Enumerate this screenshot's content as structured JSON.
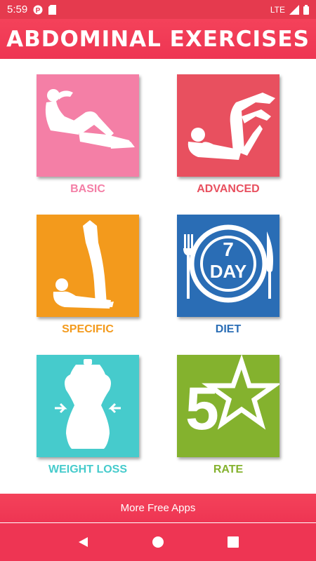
{
  "status_bar": {
    "time": "5:59",
    "network": "LTE"
  },
  "header": {
    "title": "ABDOMINAL EXERCISES"
  },
  "tiles": [
    {
      "label": "BASIC",
      "color": "#f47fa6",
      "label_color": "#f47fa6",
      "icon": "crunch-figure-icon"
    },
    {
      "label": "ADVANCED",
      "color": "#e8505f",
      "label_color": "#e8505f",
      "icon": "bicycle-crunch-figure-icon"
    },
    {
      "label": "SPECIFIC",
      "color": "#f39a1c",
      "label_color": "#f39a1c",
      "icon": "leg-raise-figure-icon"
    },
    {
      "label": "DIET",
      "color": "#2a6db5",
      "label_color": "#2a6db5",
      "icon": "diet-plate-icon",
      "plate_number": "7",
      "plate_text": "DAY"
    },
    {
      "label": "WEIGHT LOSS",
      "color": "#46cbcc",
      "label_color": "#46cbcc",
      "icon": "mannequin-icon"
    },
    {
      "label": "RATE",
      "color": "#84b22e",
      "label_color": "#84b22e",
      "icon": "five-star-icon",
      "rate_number": "5"
    }
  ],
  "bottom_bar": {
    "label": "More Free Apps"
  },
  "nav": {
    "back": "back-icon",
    "home": "home-icon",
    "recents": "recents-icon"
  }
}
